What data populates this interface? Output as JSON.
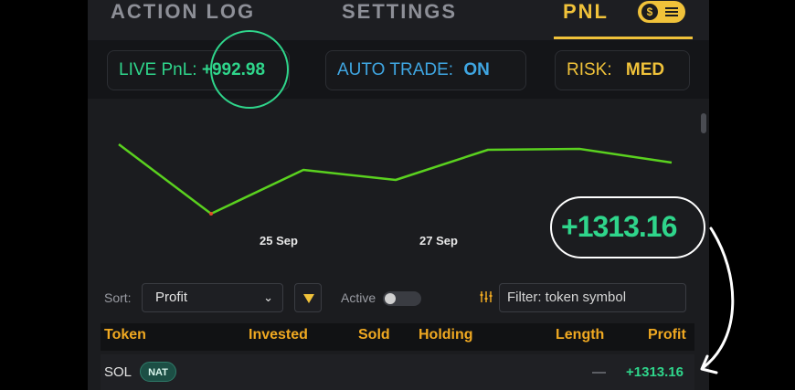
{
  "tabs": [
    {
      "label": "ACTION LOG"
    },
    {
      "label": "SETTINGS"
    },
    {
      "label": "PNL"
    }
  ],
  "status": {
    "live_label": "LIVE PnL:",
    "live_value": "+992.98",
    "auto_label": "AUTO TRADE:",
    "auto_value": "ON",
    "risk_label": "RISK:",
    "risk_value": "MED"
  },
  "chart_data": {
    "type": "line",
    "x_tick_labels": [
      "25 Sep",
      "27 Sep"
    ],
    "headline_value": "+1313.16",
    "series": [
      {
        "values": [
          null,
          null,
          null,
          null,
          null,
          null,
          null
        ]
      }
    ],
    "line_color": "#5ad11f"
  },
  "filters": {
    "sort_label": "Sort:",
    "sort_value": "Profit",
    "active_label": "Active",
    "filter_placeholder": "Filter: token symbol"
  },
  "table": {
    "headers": [
      "Token",
      "Invested",
      "Sold",
      "Holding",
      "Length",
      "Profit"
    ],
    "rows": [
      {
        "token": "SOL",
        "badge": "NAT",
        "length": "—",
        "profit": "+1313.16"
      }
    ]
  },
  "colors": {
    "accent": "#f0c23a",
    "positive": "#2fd58b",
    "info": "#3fa6e2"
  }
}
